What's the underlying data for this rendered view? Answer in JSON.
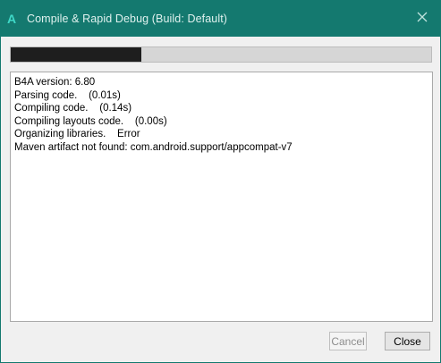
{
  "window": {
    "app_icon_glyph": "A",
    "title": "Compile & Rapid Debug (Build: Default)",
    "accent_color": "#14796f"
  },
  "progress": {
    "fraction": 0.31
  },
  "log": {
    "lines": [
      "B4A version: 6.80",
      "Parsing code.    (0.01s)",
      "Compiling code.    (0.14s)",
      "Compiling layouts code.    (0.00s)",
      "Organizing libraries.    Error",
      "Maven artifact not found: com.android.support/appcompat-v7"
    ]
  },
  "buttons": {
    "cancel_label": "Cancel",
    "cancel_enabled": false,
    "close_label": "Close"
  }
}
